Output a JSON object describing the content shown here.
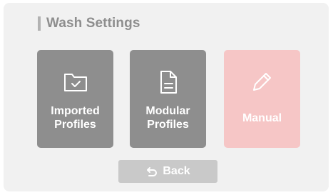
{
  "screen": {
    "title": "Wash Settings"
  },
  "tiles": [
    {
      "label": "Imported\nProfiles",
      "icon": "folder-check-icon",
      "color": "#8e8e8e"
    },
    {
      "label": "Modular\nProfiles",
      "icon": "document-icon",
      "color": "#8e8e8e"
    },
    {
      "label": "Manual",
      "icon": "pencil-icon",
      "color": "#f6c6c6"
    }
  ],
  "back": {
    "label": "Back",
    "icon": "undo-arrow-icon"
  },
  "colors": {
    "panel": "#f1f1f1",
    "tile_default": "#8e8e8e",
    "tile_highlight": "#f6c6c6",
    "back_button": "#c9c9c9",
    "header_text": "#8e8e8e"
  }
}
